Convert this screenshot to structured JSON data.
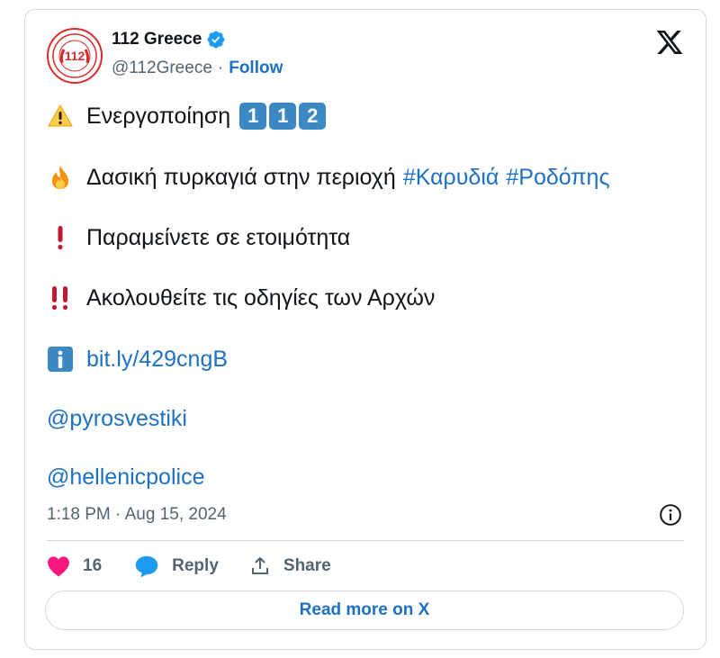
{
  "author": {
    "display_name": "112 Greece",
    "handle": "@112Greece",
    "follow_label": "Follow",
    "avatar_text": "112"
  },
  "tweet": {
    "line1_text": "Ενεργοποίηση",
    "line1_keycaps": [
      "1",
      "1",
      "2"
    ],
    "line2_text": "Δασική πυρκαγιά στην περιοχή",
    "line2_hashtags": [
      "#Καρυδιά",
      "#Ροδόπης"
    ],
    "line3_text": "Παραμείνετε σε ετοιμότητα",
    "line4_text": "Ακολουθείτε τις οδηγίες των Αρχών",
    "line5_link": "bit.ly/429cngB",
    "mention1": "@pyrosvestiki",
    "mention2": "@hellenicpolice"
  },
  "timestamp": "1:18 PM · Aug 15, 2024",
  "actions": {
    "likes_count": "16",
    "reply_label": "Reply",
    "share_label": "Share"
  },
  "read_more_label": "Read more on X",
  "icons": {
    "verified": "verified-badge-icon",
    "x_logo": "x-logo-icon",
    "warning": "warning-emoji-icon",
    "fire": "fire-emoji-icon",
    "exclamation": "exclamation-emoji-icon",
    "double_exclamation": "double-exclamation-emoji-icon",
    "information": "information-emoji-icon",
    "info": "info-circle-icon",
    "heart": "heart-icon",
    "reply": "reply-bubble-icon",
    "share": "share-icon"
  },
  "colors": {
    "link": "#1d70c2",
    "heart": "#f91880",
    "verified": "#1d9bf0",
    "border": "#cfd9de",
    "muted": "#536471"
  }
}
